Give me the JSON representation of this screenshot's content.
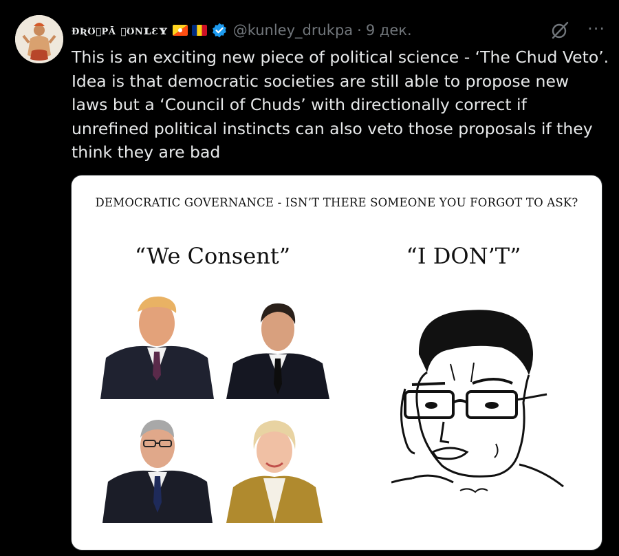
{
  "tweet": {
    "display_name": "ɖʀʊʞpā ʞʊnʟɛʏ",
    "handle": "@kunley_drukpa",
    "separator": "·",
    "date": "9 дек.",
    "text_lines": [
      "This is an exciting new piece of political science - ‘The Chud Veto’.",
      "Idea is that democratic societies are still able to propose new",
      "laws but a ‘Council of Chuds’ with directionally correct if",
      "unrefined political instincts can also veto those proposals if they",
      "think they are bad"
    ],
    "more_label": "···",
    "icons": [
      "bhutan-flag-icon",
      "romania-flag-icon",
      "verified-badge-icon",
      "grok-icon",
      "more-icon"
    ]
  },
  "meme": {
    "title": "DEMOCRATIC GOVERNANCE - ISN’T THERE SOMEONE YOU FORGOT TO ASK?",
    "left_label": "“We Consent”",
    "right_label": "“I DON’T”"
  },
  "colors": {
    "background": "#000000",
    "text": "#e7e9ea",
    "muted": "#71767b",
    "verified": "#1d9bf0"
  }
}
